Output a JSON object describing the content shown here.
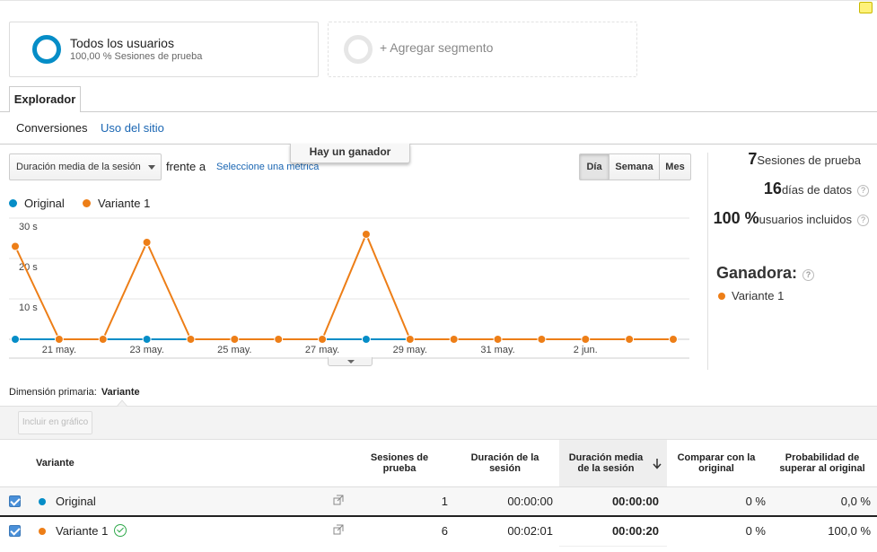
{
  "colors": {
    "original": "#058dc7",
    "variant": "#ed7e17",
    "accent": "#1a66b3"
  },
  "segments": {
    "active": {
      "title": "Todos los usuarios",
      "subtitle": "100,00 % Sesiones de prueba"
    },
    "add": {
      "label": "+ Agregar segmento"
    }
  },
  "tabs": {
    "explorer": "Explorador",
    "sub": [
      "Conversiones",
      "Uso del sitio"
    ]
  },
  "winner_popup": "Hay un ganador",
  "toolbar": {
    "metric": "Duración media de la sesión",
    "versus": "frente a",
    "select_metric": "Seleccione una métrica",
    "periods": [
      "Día",
      "Semana",
      "Mes"
    ],
    "active_period": "Día"
  },
  "legend": [
    "Original",
    "Variante 1"
  ],
  "chart_data": {
    "type": "line",
    "x": [
      "20 may.",
      "21 may.",
      "22 may.",
      "23 may.",
      "24 may.",
      "25 may.",
      "26 may.",
      "27 may.",
      "28 may.",
      "29 may.",
      "30 may.",
      "31 may.",
      "1 jun.",
      "2 jun.",
      "3 jun.",
      "4 jun."
    ],
    "x_tick_labels": [
      "21 may.",
      "23 may.",
      "25 may.",
      "27 may.",
      "29 may.",
      "31 may.",
      "2 jun."
    ],
    "y_tick_labels": [
      "30 s",
      "20 s",
      "10 s"
    ],
    "ylim": [
      0,
      30
    ],
    "grid": true,
    "series": [
      {
        "name": "Original",
        "points": [
          [
            0,
            0
          ],
          [
            3,
            0
          ],
          [
            8,
            0
          ]
        ],
        "color": "#058dc7"
      },
      {
        "name": "Variante 1",
        "values": [
          23,
          0,
          0,
          24,
          0,
          0,
          0,
          0,
          26,
          0,
          0,
          0,
          0,
          0,
          0,
          0
        ],
        "color": "#ed7e17"
      }
    ]
  },
  "stats": [
    {
      "value": "7",
      "label": "Sesiones de prueba"
    },
    {
      "value": "16",
      "label": "días de datos"
    },
    {
      "value": "100 %",
      "label": "usuarios incluidos"
    }
  ],
  "winner": {
    "title": "Ganadora:",
    "item": "Variante 1"
  },
  "dimension": {
    "label": "Dimensión primaria:",
    "value": "Variante"
  },
  "include_button": "Incluir en gráfico",
  "table": {
    "headers": [
      "Variante",
      "Sesiones de prueba",
      "Duración de la sesión",
      "Duración media de la sesión",
      "Comparar con la original",
      "Probabilidad de superar al original"
    ],
    "rows": [
      {
        "name": "Original",
        "sessions": "1",
        "duration": "00:00:00",
        "avg": "00:00:00",
        "compare": "0 %",
        "prob": "0,0 %"
      },
      {
        "name": "Variante 1",
        "sessions": "6",
        "duration": "00:02:01",
        "avg": "00:00:20",
        "compare": "0 %",
        "prob": "100,0 %"
      }
    ]
  }
}
